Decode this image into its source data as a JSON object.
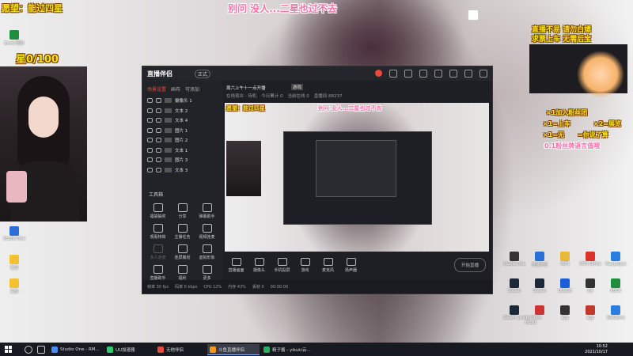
{
  "overlay": {
    "goal_top_left": "愿望：能过四星",
    "center_top": "别问 没人...二星也过不去",
    "star_counter": "星0/100",
    "notice_right_1": "直播不易 请勿白嫖",
    "notice_right_2": "求票上车 无需后宝",
    "rules": [
      "×1加入粉丝团",
      "×1=上车",
      "×2=展览",
      "×1=无",
      "=你说了算",
      "0.1粉丝牌语言值哦"
    ]
  },
  "desktop_icons_left": [
    {
      "label": "Excel 图标",
      "color": "#1e8e3e"
    },
    {
      "label": "Studio One",
      "color": "#2a6fd6"
    },
    {
      "label": "资源",
      "color": "#f2c230"
    },
    {
      "label": "资源",
      "color": "#f2c230"
    }
  ],
  "desktop_icons_right": [
    {
      "label": "Studio One",
      "color": "#333333"
    },
    {
      "label": "直播伴侣",
      "color": "#2a6fd6"
    },
    {
      "label": "WPS",
      "color": "#e8b93a"
    },
    {
      "label": "WPS Office",
      "color": "#d9332b"
    },
    {
      "label": "XiaoJueJue",
      "color": "#2a7de1"
    },
    {
      "label": "Steam",
      "color": "#1b2838"
    },
    {
      "label": "Steam",
      "color": "#1b2838"
    },
    {
      "label": "Ubisoft",
      "color": "#1b5dd6"
    },
    {
      "label": "ew",
      "color": "#333333"
    },
    {
      "label": "XBOX",
      "color": "#1e8e3e"
    },
    {
      "label": "Steam Live",
      "color": "#1b2838"
    },
    {
      "label": "YouTube Music",
      "color": "#cc3333"
    },
    {
      "label": "app",
      "color": "#333333"
    },
    {
      "label": "app",
      "color": "#c0392b"
    },
    {
      "label": "WeGame",
      "color": "#2a7de1"
    }
  ],
  "app": {
    "title": "直播伴侣",
    "version": "正式",
    "scene_tabs": [
      "场景设置",
      "画布",
      "可添加"
    ],
    "sources": [
      "摄像头 1",
      "文本 2",
      "文本 4",
      "图片 1",
      "图片 2",
      "文本 1",
      "图片 3",
      "文本 3"
    ],
    "tools_label": "工具箱",
    "tools": [
      {
        "label": "福袋抽奖",
        "dim": false
      },
      {
        "label": "分享",
        "dim": false
      },
      {
        "label": "弹幕助手",
        "dim": false
      },
      {
        "label": "观看特效",
        "dim": false
      },
      {
        "label": "主播任务",
        "dim": false
      },
      {
        "label": "视频连麦",
        "dim": false
      },
      {
        "label": "多人连麦",
        "dim": true
      },
      {
        "label": "连屏策划",
        "dim": false
      },
      {
        "label": "虚拟形象",
        "dim": false
      },
      {
        "label": "直播助手",
        "dim": false
      },
      {
        "label": "福利",
        "dim": false
      },
      {
        "label": "更多",
        "dim": false
      }
    ],
    "room_title": "周六上午十一点开播",
    "room_tag": "游戏",
    "room_info": [
      "在线观众 · 待机",
      "今日累计 0",
      "当前在线 0",
      "直播间 88237"
    ],
    "bottom_buttons": [
      "直播画面",
      "摄像头",
      "手机投屏",
      "游戏",
      "麦克风",
      "扬声器"
    ],
    "start_live": "开始直播",
    "status": [
      "帧率 30 fps",
      "码率 0 kbps",
      "CPU 12%",
      "内存 43%",
      "丢帧 0",
      "00:00:00"
    ]
  },
  "taskbar": {
    "items": [
      {
        "label": "Studio One - RM...",
        "color": "#4b8df8",
        "active": false
      },
      {
        "label": "UU加速器",
        "color": "#2ecc71",
        "active": false
      },
      {
        "label": "无他伴侣",
        "color": "#e84b3b",
        "active": false
      },
      {
        "label": "斗鱼直播伴侣",
        "color": "#f29b1a",
        "active": true
      },
      {
        "label": "精子酱 - yikuki云...",
        "color": "#27ae60",
        "active": false
      }
    ],
    "time": "10:52",
    "date": "2021/10/17"
  }
}
